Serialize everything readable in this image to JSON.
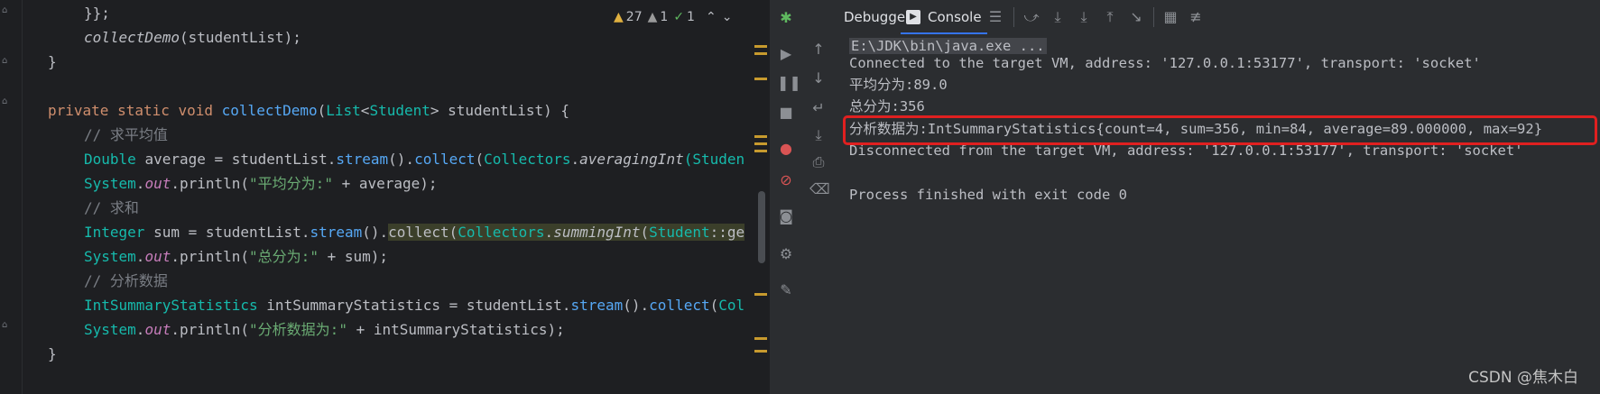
{
  "editor": {
    "lines": [
      {
        "parts": [
          {
            "t": "}};",
            "c": ""
          }
        ]
      },
      {
        "parts": [
          {
            "t": "collectDemo",
            "c": "it"
          },
          {
            "t": "(studentList);",
            "c": ""
          }
        ]
      },
      {
        "parts": [
          {
            "t": "}",
            "c": ""
          }
        ]
      },
      {
        "parts": [
          {
            "t": "",
            "c": ""
          }
        ]
      },
      {
        "parts": [
          {
            "t": "private static void ",
            "c": "kw"
          },
          {
            "t": "collectDemo",
            "c": "fn"
          },
          {
            "t": "(",
            "c": ""
          },
          {
            "t": "List",
            "c": "ty"
          },
          {
            "t": "<",
            "c": ""
          },
          {
            "t": "Student",
            "c": "ty"
          },
          {
            "t": "> studentList) {",
            "c": ""
          }
        ]
      },
      {
        "parts": [
          {
            "t": "// 求平均值",
            "c": "cm"
          }
        ]
      },
      {
        "parts": [
          {
            "t": "Double ",
            "c": "ty"
          },
          {
            "t": "average = studentList.",
            "c": ""
          },
          {
            "t": "stream",
            "c": "fn"
          },
          {
            "t": "().",
            "c": ""
          },
          {
            "t": "collect",
            "c": "fn"
          },
          {
            "t": "(",
            "c": ""
          },
          {
            "t": "Collectors",
            "c": "ty"
          },
          {
            "t": ".",
            "c": ""
          },
          {
            "t": "averagingInt",
            "c": "it"
          },
          {
            "t": "(Studen",
            "c": "ty"
          }
        ]
      },
      {
        "parts": [
          {
            "t": "System",
            "c": "ty"
          },
          {
            "t": ".",
            "c": ""
          },
          {
            "t": "out",
            "c": "st"
          },
          {
            "t": ".println(",
            "c": ""
          },
          {
            "t": "\"平均分为:\"",
            "c": "str"
          },
          {
            "t": " + average);",
            "c": ""
          }
        ]
      },
      {
        "parts": [
          {
            "t": "// 求和",
            "c": "cm"
          }
        ]
      },
      {
        "parts": [
          {
            "t": "Integer ",
            "c": "ty"
          },
          {
            "t": "sum = studentList.",
            "c": ""
          },
          {
            "t": "stream",
            "c": "fn"
          },
          {
            "t": "().",
            "c": ""
          },
          {
            "t": "collect(",
            "c": "hl"
          },
          {
            "t": "Collectors",
            "c": "hl ty"
          },
          {
            "t": ".",
            "c": "hl"
          },
          {
            "t": "summingInt",
            "c": "hl it"
          },
          {
            "t": "(",
            "c": "hl"
          },
          {
            "t": "Student",
            "c": "hl ty"
          },
          {
            "t": "::ge",
            "c": "hl"
          }
        ]
      },
      {
        "parts": [
          {
            "t": "System",
            "c": "ty"
          },
          {
            "t": ".",
            "c": ""
          },
          {
            "t": "out",
            "c": "st"
          },
          {
            "t": ".println(",
            "c": ""
          },
          {
            "t": "\"总分为:\"",
            "c": "str"
          },
          {
            "t": " + sum);",
            "c": ""
          }
        ]
      },
      {
        "parts": [
          {
            "t": "// 分析数据",
            "c": "cm"
          }
        ]
      },
      {
        "parts": [
          {
            "t": "IntSummaryStatistics ",
            "c": "ty"
          },
          {
            "t": "intSummaryStatistics = studentList.",
            "c": ""
          },
          {
            "t": "stream",
            "c": "fn"
          },
          {
            "t": "().",
            "c": ""
          },
          {
            "t": "collect",
            "c": "fn"
          },
          {
            "t": "(",
            "c": ""
          },
          {
            "t": "Col",
            "c": "ty"
          }
        ]
      },
      {
        "parts": [
          {
            "t": "System",
            "c": "ty"
          },
          {
            "t": ".",
            "c": ""
          },
          {
            "t": "out",
            "c": "st"
          },
          {
            "t": ".println(",
            "c": ""
          },
          {
            "t": "\"分析数据为:\"",
            "c": "str"
          },
          {
            "t": " + intSummaryStatistics);",
            "c": ""
          }
        ]
      },
      {
        "parts": [
          {
            "t": "}",
            "c": ""
          }
        ]
      }
    ],
    "inspection": {
      "warnings": "27",
      "weak_warnings": "1",
      "typos": "1"
    }
  },
  "tabs": {
    "debugger": "Debugger",
    "console": "Console"
  },
  "console": {
    "lines": [
      "E:\\JDK\\bin\\java.exe ...",
      "Connected to the target VM, address: '127.0.0.1:53177', transport: 'socket'",
      "平均分为:89.0",
      "总分为:356",
      "分析数据为:IntSummaryStatistics{count=4, sum=356, min=84, average=89.000000, max=92}",
      "Disconnected from the target VM, address: '127.0.0.1:53177', transport: 'socket'",
      "",
      "Process finished with exit code 0"
    ]
  },
  "watermark": "CSDN @焦木白",
  "colors": {
    "accent": "#3574f0",
    "highlight_box": "#e02020"
  }
}
